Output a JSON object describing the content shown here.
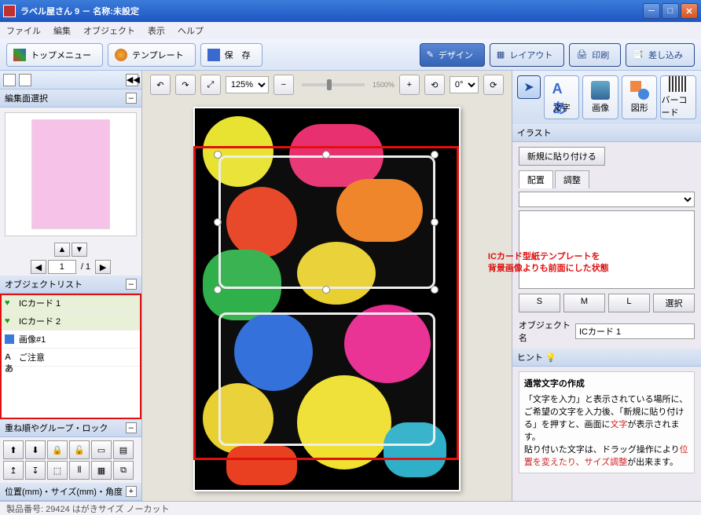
{
  "window": {
    "title": "ラベル屋さん 9 － 名称:未設定"
  },
  "menu": {
    "file": "ファイル",
    "edit": "編集",
    "object": "オブジェクト",
    "view": "表示",
    "help": "ヘルプ"
  },
  "toolbar": {
    "top_menu": "トップメニュー",
    "template": "テンプレート",
    "save": "保　存",
    "design": "デザイン",
    "layout": "レイアウト",
    "print": "印刷",
    "merge": "差し込み"
  },
  "left": {
    "edit_face_header": "編集面選択",
    "object_list_header": "オブジェクトリスト",
    "items": [
      {
        "icon": "heart",
        "label": "ICカード 1",
        "selected": true
      },
      {
        "icon": "heart",
        "label": "ICカード 2",
        "selected": true
      },
      {
        "icon": "img",
        "label": "画像#1",
        "selected": false
      },
      {
        "icon": "txt",
        "label": "ご注意",
        "selected": false
      }
    ],
    "stack_header": "重ね順やグループ・ロック",
    "pos_size_header": "位置(mm)・サイズ(mm)・角度",
    "page_current": "1",
    "page_total": "/ 1"
  },
  "canvas_toolbar": {
    "zoom": "125%",
    "zoom_label": "1500%",
    "rotation": "0°"
  },
  "right": {
    "palette": {
      "text": "文字",
      "image": "画像",
      "shape": "図形",
      "barcode": "バーコード"
    },
    "illust_header": "イラスト",
    "paste_new": "新規に貼り付ける",
    "tab_place": "配置",
    "tab_adjust": "調整",
    "size_s": "S",
    "size_m": "M",
    "size_l": "L",
    "select_btn": "選択",
    "object_name_label": "オブジェクト名",
    "object_name_value": "ICカード 1",
    "hint_header": "ヒント 💡",
    "hint_title": "通常文字の作成",
    "hint_line1_a": "「文字を入力」と表示されている場所に、ご希望の文字を入力後、「新規に貼り付ける」を押すと、画面に",
    "hint_line1_b": "文字",
    "hint_line1_c": "が表示されます。",
    "hint_line2_a": "貼り付いた文字は、ドラッグ操作により",
    "hint_line2_b": "位置を変えたり、サイズ調整",
    "hint_line2_c": "が出来ます。"
  },
  "annotation": {
    "line1": "ICカード型紙テンプレートを",
    "line2": "背景画像よりも前面にした状態"
  },
  "statusbar": {
    "text": "製品番号: 29424 はがきサイズ ノーカット"
  }
}
